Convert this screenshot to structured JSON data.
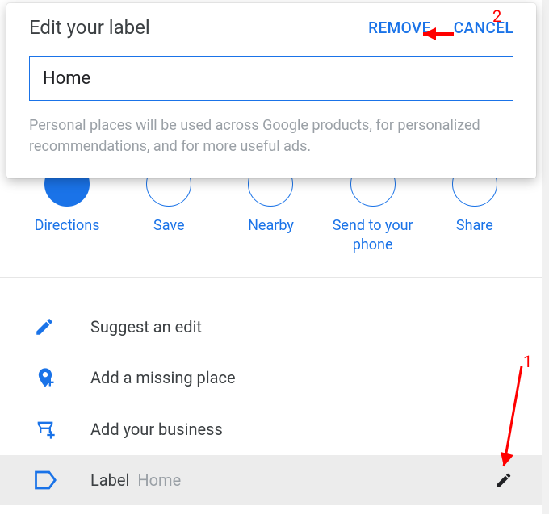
{
  "modal": {
    "title": "Edit your label",
    "remove": "REMOVE",
    "cancel": "CANCEL",
    "input_value": "Home",
    "hint": "Personal places will be used across Google products, for personalized recommendations, and for more useful ads."
  },
  "actions": {
    "directions": "Directions",
    "save": "Save",
    "nearby": "Nearby",
    "send": "Send to your phone",
    "share": "Share"
  },
  "list": {
    "suggest": "Suggest an edit",
    "add_place": "Add a missing place",
    "add_business": "Add your business",
    "label_title": "Label",
    "label_value": "Home"
  },
  "annotations": {
    "one": "1",
    "two": "2"
  }
}
